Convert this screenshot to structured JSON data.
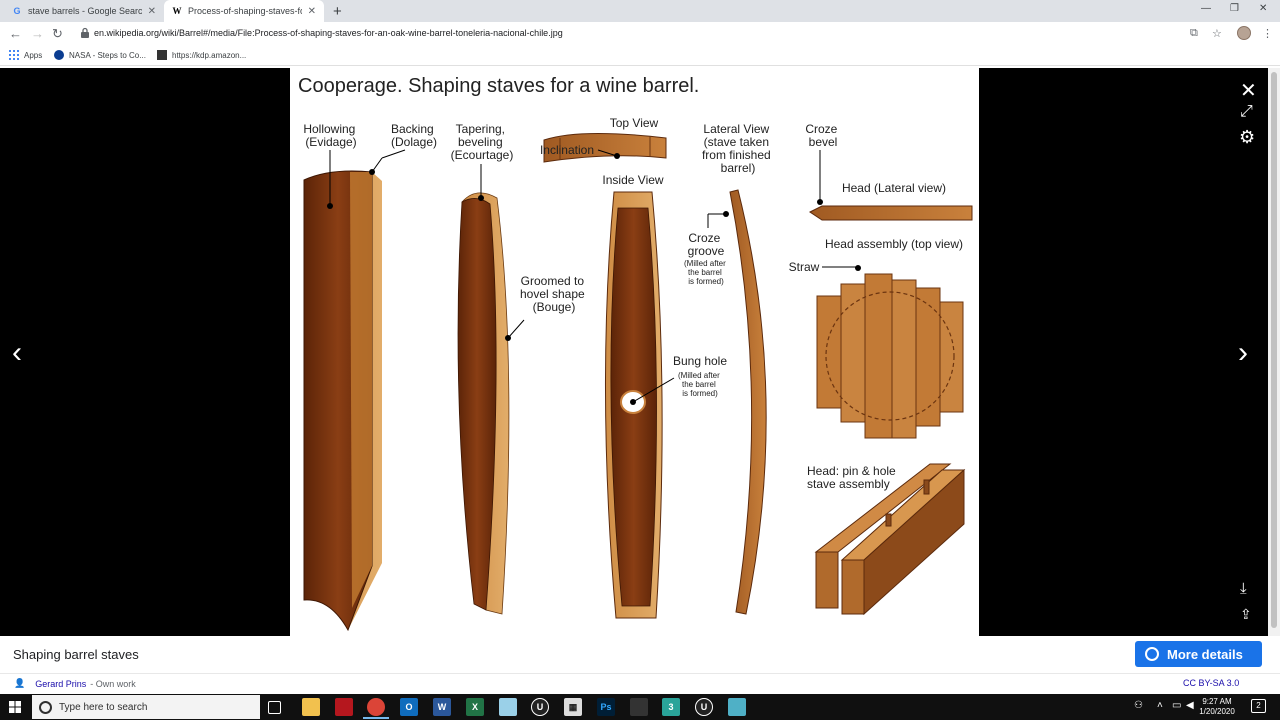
{
  "browser": {
    "tabs": [
      {
        "title": "stave barrels - Google Search",
        "favicon": "G"
      },
      {
        "title": "Process-of-shaping-staves-for-a",
        "favicon": "W"
      }
    ],
    "url": "en.wikipedia.org/wiki/Barrel#/media/File:Process-of-shaping-staves-for-an-oak-wine-barrel-toneleria-nacional-chile.jpg",
    "bookmarks": [
      {
        "label": "Apps"
      },
      {
        "label": "NASA - Steps to Co..."
      },
      {
        "label": "https://kdp.amazon..."
      }
    ]
  },
  "figure": {
    "title": "Cooperage. Shaping staves for a wine barrel.",
    "labels": {
      "hollowing": [
        "Hollowing",
        "(Evidage)"
      ],
      "backing": [
        "Backing",
        "(Dolage)"
      ],
      "tapering": [
        "Tapering,",
        "beveling",
        "(Ecourtage)"
      ],
      "top_view": "Top View",
      "inclination": "Inclination",
      "inside_view": "Inside View",
      "lateral_view": [
        "Lateral View",
        "(stave taken",
        "from finished",
        "barrel)"
      ],
      "croze_bevel": [
        "Croze",
        "bevel"
      ],
      "head_lateral": "Head (Lateral view)",
      "croze_groove": [
        "Croze",
        "groove"
      ],
      "croze_groove_note": [
        "(Milled after",
        "the barrel",
        "is formed)"
      ],
      "head_assembly": "Head assembly (top view)",
      "straw": "Straw",
      "groomed": [
        "Groomed to",
        "hovel shape",
        "(Bouge)"
      ],
      "bung_hole": "Bung hole",
      "bung_note": [
        "(Milled after",
        "the barrel",
        "is formed)"
      ],
      "pin_hole": [
        "Head: pin & hole",
        "stave assembly"
      ]
    }
  },
  "caption": {
    "title": "Shaping barrel staves",
    "more_details": "More details",
    "author": "Gerard Prins",
    "author_suffix": "- Own work",
    "license": "CC BY-SA 3.0"
  },
  "taskbar": {
    "search_placeholder": "Type here to search",
    "time": "9:27 AM",
    "date": "1/20/2020",
    "notifications": "2"
  },
  "colors": {
    "wood_dark": "#7a3410",
    "wood_mid": "#b0662a",
    "wood_light": "#d79a55",
    "accent": "#1a73e8"
  }
}
